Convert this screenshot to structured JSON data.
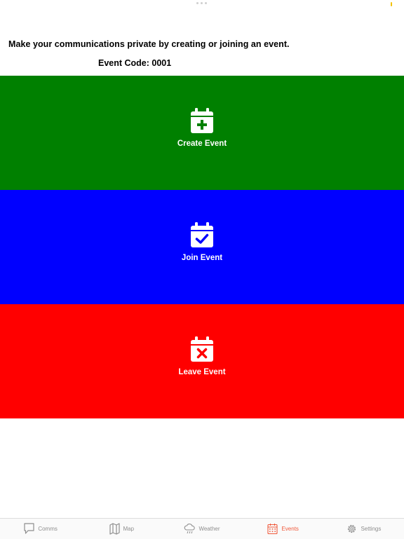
{
  "header": {
    "message": "Make your communications private by creating or joining an event.",
    "event_code": "Event Code: 0001"
  },
  "actions": [
    {
      "label": "Create Event",
      "color": "#008000",
      "icon": "calendar-plus-icon"
    },
    {
      "label": "Join Event",
      "color": "#0000ff",
      "icon": "calendar-check-icon"
    },
    {
      "label": "Leave Event",
      "color": "#ff0000",
      "icon": "calendar-x-icon"
    }
  ],
  "tabs": [
    {
      "label": "Comms",
      "icon": "chat-bubble-icon",
      "active": false
    },
    {
      "label": "Map",
      "icon": "map-icon",
      "active": false
    },
    {
      "label": "Weather",
      "icon": "cloud-rain-icon",
      "active": false
    },
    {
      "label": "Events",
      "icon": "calendar-icon",
      "active": true
    },
    {
      "label": "Settings",
      "icon": "gear-icon",
      "active": false
    }
  ],
  "colors": {
    "active_tab": "#f05a3c",
    "inactive_tab": "#8e8e8e"
  }
}
